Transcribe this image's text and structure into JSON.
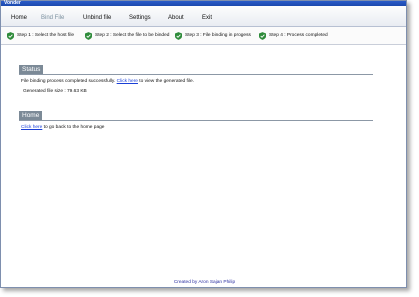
{
  "window": {
    "title": "Vonder"
  },
  "menu": {
    "items": [
      {
        "label": "Home"
      },
      {
        "label": "Bind File"
      },
      {
        "label": "Unbind file"
      },
      {
        "label": "Settings"
      },
      {
        "label": "About"
      },
      {
        "label": "Exit"
      }
    ],
    "active_index": 1
  },
  "steps": [
    {
      "label": "Step 1 : Select the host file"
    },
    {
      "label": "Step 2 : Select the file to be binded"
    },
    {
      "label": "Step 3 : File binding in progess"
    },
    {
      "label": "Step 4 : Process completed"
    }
  ],
  "status": {
    "header": "Status",
    "message_before": "File binding process completed successfully. ",
    "link_text": "Click here",
    "message_after": " to view the generated file.",
    "file_size": "Generated file size : 79.63 KB"
  },
  "home": {
    "header": "Home",
    "link_text": "Click here",
    "message_after": " to go back to the home page"
  },
  "footer": {
    "credit": "Created by Aron Sajan Philip"
  },
  "colors": {
    "accent": "#1a3fd6",
    "section_header": "#7c8a97",
    "step_icon": "#2e8b3a"
  }
}
